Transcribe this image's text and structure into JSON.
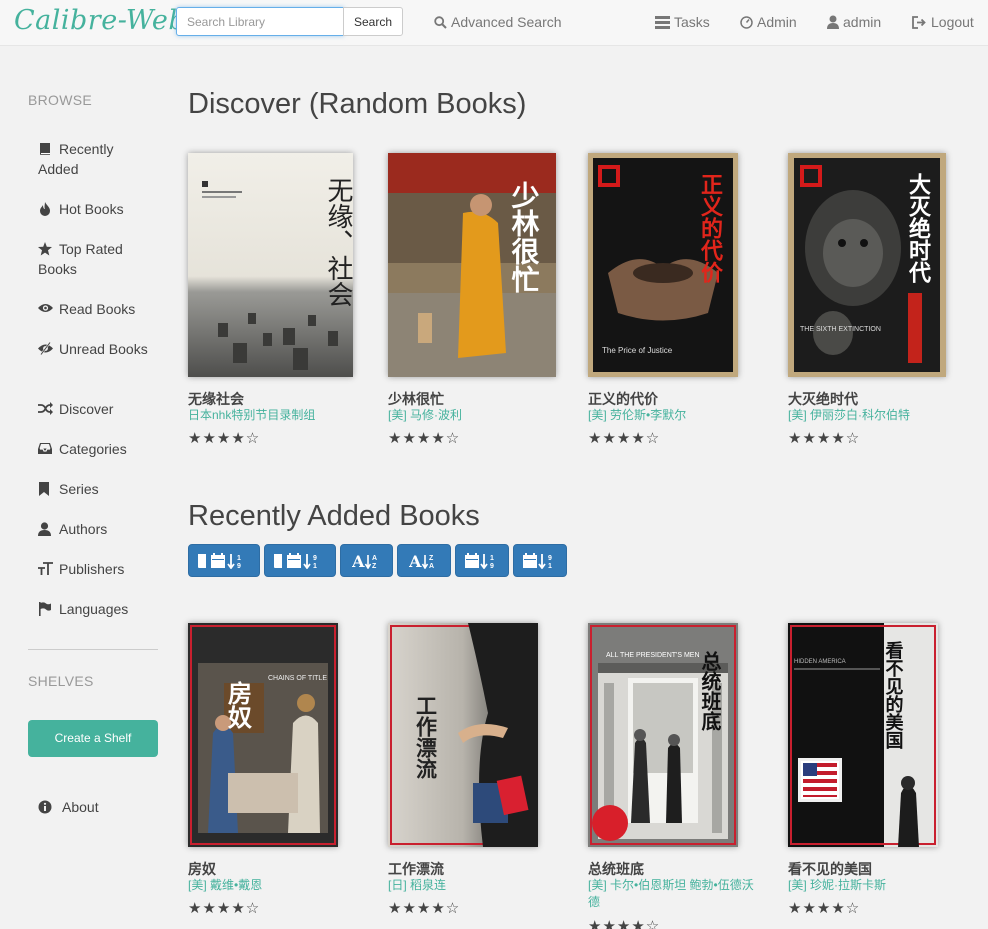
{
  "brand": "Calibre-Web",
  "search": {
    "placeholder": "Search Library",
    "button": "Search"
  },
  "nav": {
    "advanced_search": "Advanced Search",
    "tasks": "Tasks",
    "admin": "Admin",
    "user": "admin",
    "logout": "Logout"
  },
  "sidebar": {
    "browse_header": "BROWSE",
    "items": [
      {
        "label": "Recently Added",
        "icon": "book-icon"
      },
      {
        "label": "Hot Books",
        "icon": "fire-icon"
      },
      {
        "label": "Top Rated Books",
        "icon": "star-icon"
      },
      {
        "label": "Read Books",
        "icon": "eye-icon"
      },
      {
        "label": "Unread Books",
        "icon": "eye-slash-icon"
      },
      {
        "label": "Discover",
        "icon": "random-icon"
      },
      {
        "label": "Categories",
        "icon": "inbox-icon"
      },
      {
        "label": "Series",
        "icon": "bookmark-icon"
      },
      {
        "label": "Authors",
        "icon": "user-icon"
      },
      {
        "label": "Publishers",
        "icon": "text-size-icon"
      },
      {
        "label": "Languages",
        "icon": "flag-icon"
      }
    ],
    "shelves_header": "SHELVES",
    "create_shelf": "Create a Shelf",
    "about": "About"
  },
  "discover": {
    "title": "Discover (Random Books)",
    "books": [
      {
        "title": "无缘社会",
        "author": "日本nhk特别节目录制组",
        "rating": 4,
        "stars": "★★★★☆"
      },
      {
        "title": "少林很忙",
        "author": "[美] 马修·波利",
        "rating": 4,
        "stars": "★★★★☆"
      },
      {
        "title": "正义的代价",
        "author": "[美] 劳伦斯•李默尔",
        "rating": 4,
        "stars": "★★★★☆"
      },
      {
        "title": "大灭绝时代",
        "author": "[美] 伊丽莎白·科尔伯特",
        "rating": 4,
        "stars": "★★★★☆"
      }
    ]
  },
  "recent": {
    "title": "Recently Added Books",
    "sort_buttons": [
      {
        "name": "sort-by-added-new-button",
        "label": "Added ↓"
      },
      {
        "name": "sort-by-added-old-button",
        "label": "Added ↑"
      },
      {
        "name": "sort-title-az-button",
        "label": "A↓Z"
      },
      {
        "name": "sort-title-za-button",
        "label": "A↑Z"
      },
      {
        "name": "sort-pubdate-new-button",
        "label": "Date ↓"
      },
      {
        "name": "sort-pubdate-old-button",
        "label": "Date ↑"
      }
    ],
    "books": [
      {
        "title": "房奴",
        "author": "[美] 戴维•戴恩",
        "rating": 4,
        "stars": "★★★★☆"
      },
      {
        "title": "工作漂流",
        "author": "[日] 稻泉连",
        "rating": 4,
        "stars": "★★★★☆"
      },
      {
        "title": "总统班底",
        "author": "[美] 卡尔•伯恩斯坦 鲍勃•伍德沃德",
        "rating": 4,
        "stars": "★★★★☆"
      },
      {
        "title": "看不见的美国",
        "author": "[美] 珍妮·拉斯卡斯",
        "rating": 4,
        "stars": "★★★★☆"
      }
    ]
  },
  "covers": {
    "c1": {
      "text": "无缘、社会"
    },
    "c2": {
      "text": "少林很忙"
    },
    "c3": {
      "text": "正义的代价",
      "sub": "The Price of Justice"
    },
    "c4": {
      "text": "大灭绝时代",
      "sub": "THE SIXTH EXTINCTION"
    },
    "c5": {
      "text": "房奴",
      "sub": "CHAINS OF TITLE"
    },
    "c6": {
      "text": "工作漂流"
    },
    "c7": {
      "text": "总统班底",
      "sub": "ALL THE PRESIDENT'S MEN"
    },
    "c8": {
      "text": "看不见的美国",
      "sub": "HIDDEN AMERICA"
    }
  }
}
